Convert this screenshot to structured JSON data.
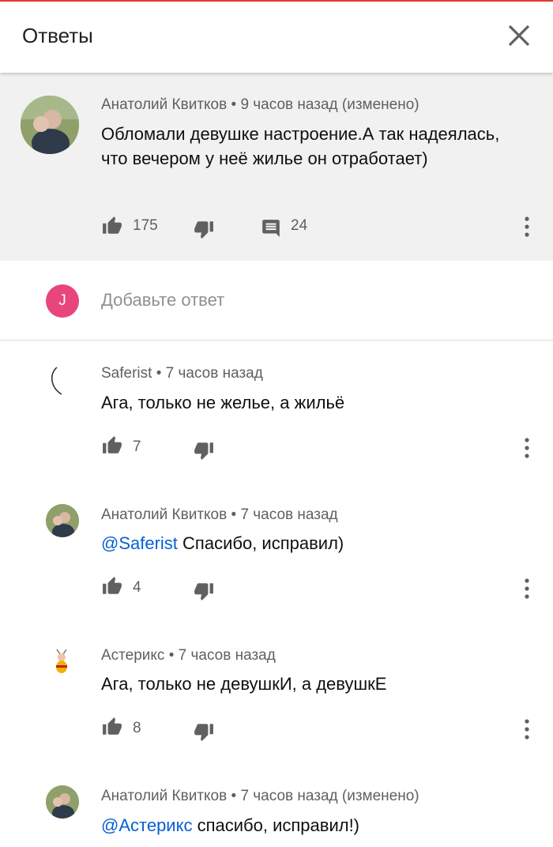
{
  "header": {
    "title": "Ответы",
    "close_icon": "close-icon"
  },
  "parent_comment": {
    "author": "Анатолий Квитков",
    "time": "9 часов назад (изменено)",
    "text": "Обломали девушке настроение.А так надеялась, что вечером у неё жилье он отработает)",
    "likes": "175",
    "replies": "24"
  },
  "reply_box": {
    "avatar_letter": "J",
    "placeholder": "Добавьте ответ",
    "avatar_color": "#e8457c"
  },
  "replies": [
    {
      "author": "Saferist",
      "time": "7 часов назад",
      "mention": "",
      "text": "Ага, только не желье, а жильё",
      "likes": "7"
    },
    {
      "author": "Анатолий Квитков",
      "time": "7 часов назад",
      "mention": "@Saferist",
      "text": " Спасибо, исправил)",
      "likes": "4"
    },
    {
      "author": "Астерикс",
      "time": "7 часов назад",
      "mention": "",
      "text": "Ага, только не девушкИ, а девушкЕ",
      "likes": "8"
    },
    {
      "author": "Анатолий Квитков",
      "time": "7 часов назад (изменено)",
      "mention": "@Астерикс",
      "text": " спасибо, исправил!)",
      "likes": ""
    }
  ],
  "colors": {
    "accent_red": "#e53935",
    "link_blue": "#065fd4",
    "meta_gray": "#606060"
  }
}
